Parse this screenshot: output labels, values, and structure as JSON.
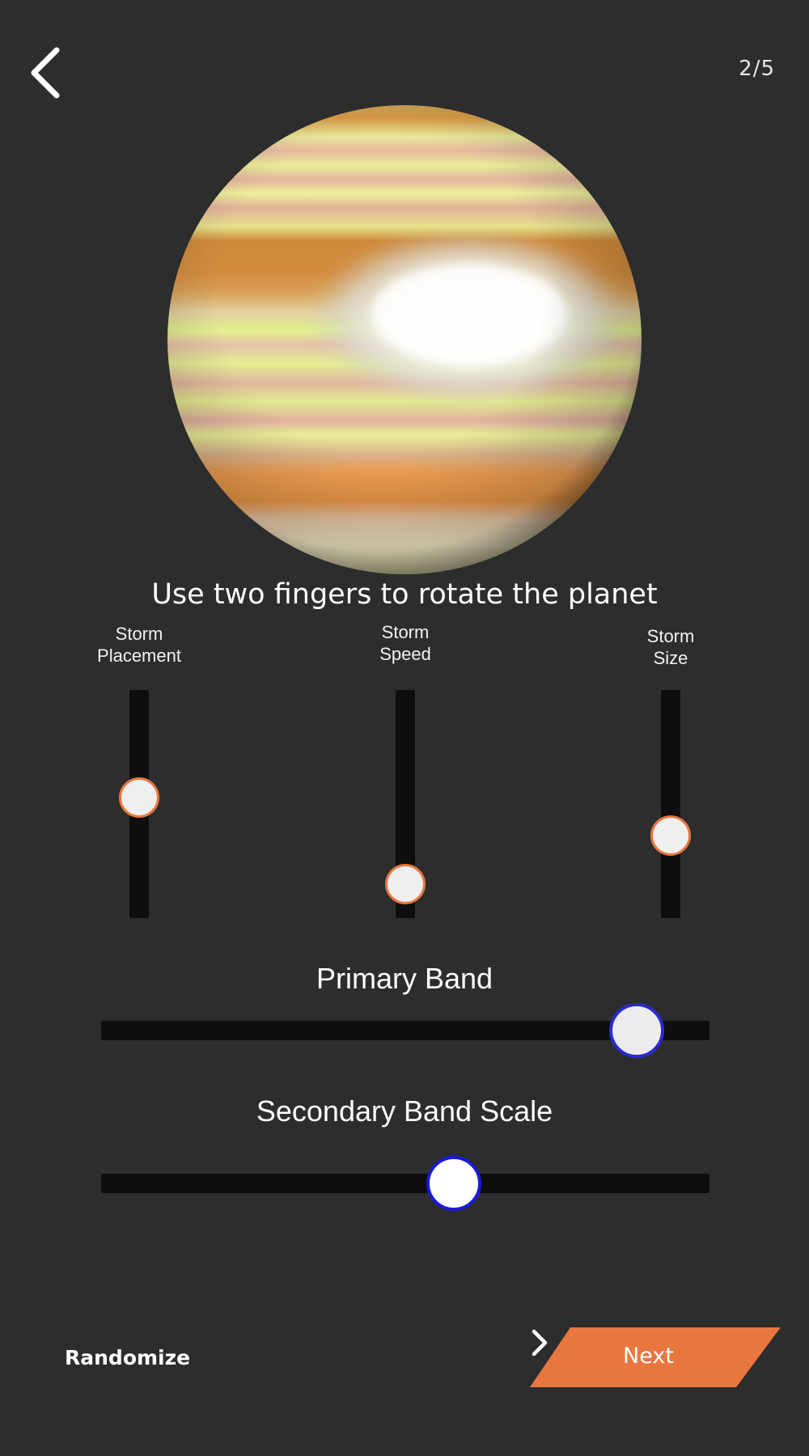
{
  "header": {
    "page_indicator": "2/5"
  },
  "main": {
    "instruction": "Use two fingers to rotate the planet"
  },
  "vertical_sliders": [
    {
      "label_line1": "Storm",
      "label_line2": "Placement",
      "value": 0.53
    },
    {
      "label_line1": "Storm",
      "label_line2": "Speed",
      "value": 0.15
    },
    {
      "label_line1": "Storm",
      "label_line2": "Size",
      "value": 0.36
    }
  ],
  "horizontal_sliders": [
    {
      "label": "Primary Band",
      "value": 0.88
    },
    {
      "label": "Secondary Band Scale",
      "value": 0.58
    }
  ],
  "footer": {
    "randomize_label": "Randomize",
    "next_label": "Next"
  },
  "colors": {
    "background": "#2c2d2c",
    "accent": "#e8763f",
    "track": "#0d0e0d",
    "thumb_border_blue": "#2a2ad0"
  },
  "icons": {
    "back": "chevron-left-icon",
    "next": "chevron-right-icon"
  }
}
